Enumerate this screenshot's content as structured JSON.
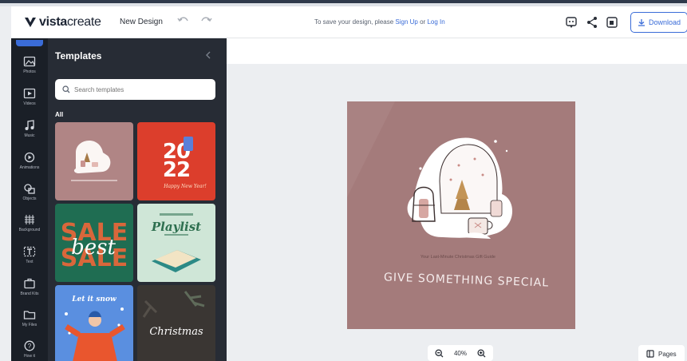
{
  "header": {
    "logo_bold": "vista",
    "logo_light": "create",
    "design_name": "New Design",
    "save_prefix": "To save your design, please",
    "signup_link": "Sign Up",
    "or_text": "or",
    "login_link": "Log In",
    "download_label": "Download"
  },
  "nav": {
    "items": [
      {
        "label": "Photos",
        "icon": "photo-icon"
      },
      {
        "label": "Videos",
        "icon": "video-icon"
      },
      {
        "label": "Music",
        "icon": "music-icon"
      },
      {
        "label": "Animations",
        "icon": "animation-icon"
      },
      {
        "label": "Objects",
        "icon": "objects-icon"
      },
      {
        "label": "Background",
        "icon": "background-icon"
      },
      {
        "label": "Text",
        "icon": "text-icon"
      },
      {
        "label": "Brand Kits",
        "icon": "brand-kit-icon"
      },
      {
        "label": "My Files",
        "icon": "folder-icon"
      },
      {
        "label": "How it",
        "icon": "help-icon"
      }
    ]
  },
  "panel": {
    "title": "Templates",
    "search_placeholder": "Search templates",
    "section_label": "All",
    "templates": [
      {
        "name": "snow-globe-template",
        "text": ""
      },
      {
        "name": "year-2022-template",
        "big": "2022",
        "small": "Happy New Year!"
      },
      {
        "name": "best-sale-template",
        "big": "SALE",
        "script": "best"
      },
      {
        "name": "playlist-template",
        "small": "",
        "script": "Playlist"
      },
      {
        "name": "let-it-snow-template",
        "script": "Let it snow"
      },
      {
        "name": "merry-christmas-template",
        "script": "Christmas"
      }
    ]
  },
  "canvas": {
    "subtitle": "Your Last-Minute Christmas Gift Guide",
    "headline": "GIVE SOMETHING SPECIAL",
    "zoom": "40%",
    "pages_label": "Pages"
  },
  "colors": {
    "accent": "#3a6cd8",
    "artboard": "#a47b7b",
    "panel": "#272c35",
    "nav": "#1a1f27"
  }
}
